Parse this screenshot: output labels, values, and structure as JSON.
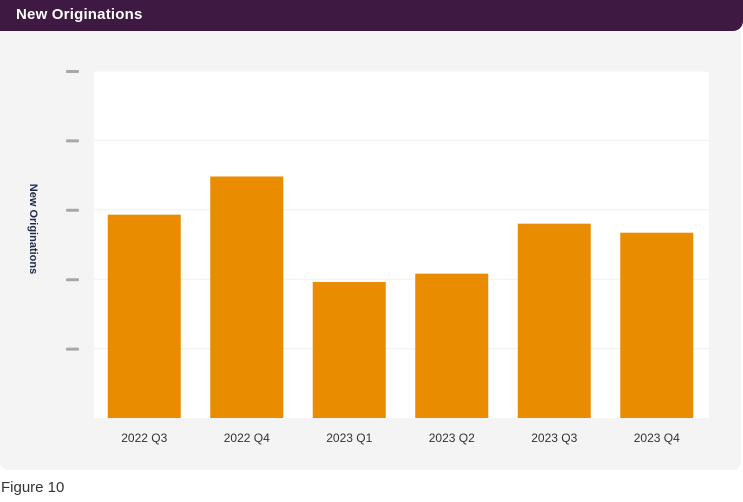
{
  "header": {
    "title": "New Originations"
  },
  "caption": "Figure 10",
  "colors": {
    "header_bg": "#3e1a43",
    "bar": "#ea8c00",
    "panel_bg": "#f4f4f4"
  },
  "chart_data": {
    "type": "bar",
    "ylabel": "New Originations",
    "categories": [
      "2022 Q3",
      "2022 Q4",
      "2023 Q1",
      "2023 Q2",
      "2023 Q3",
      "2023 Q4"
    ],
    "values": [
      2.93,
      3.48,
      1.96,
      2.08,
      2.8,
      2.67
    ],
    "ylim": [
      0,
      5
    ],
    "yticks_hidden": true,
    "grid": true,
    "legend": "none"
  }
}
